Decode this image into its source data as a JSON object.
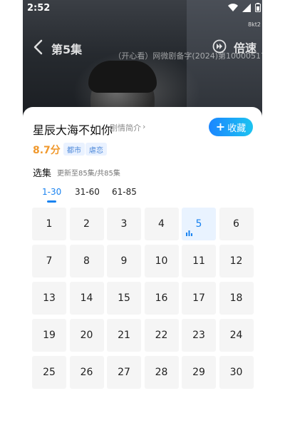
{
  "status_bar": {
    "time": "2:52",
    "icons": [
      "wifi-icon",
      "signal-icon",
      "battery-icon"
    ],
    "tag": "8kt2"
  },
  "player": {
    "episode_title": "第5集",
    "speed_label": "倍速",
    "license_text": "（开心看）网微剧备字(2024)第10000517号"
  },
  "drama": {
    "title": "星辰大海不如你",
    "intro_link": "剧情简介",
    "score": "8.7分",
    "tags": [
      "都市",
      "虐恋"
    ],
    "collect_label": "收藏"
  },
  "episodes": {
    "label": "选集",
    "status": "更新至85集/共85集",
    "ranges": [
      "1-30",
      "31-60",
      "61-85"
    ],
    "active_range": "1-30",
    "current": "5",
    "list": [
      "1",
      "2",
      "3",
      "4",
      "5",
      "6",
      "7",
      "8",
      "9",
      "10",
      "11",
      "12",
      "13",
      "14",
      "15",
      "16",
      "17",
      "18",
      "19",
      "20",
      "21",
      "22",
      "23",
      "24",
      "25",
      "26",
      "27",
      "28",
      "29",
      "30"
    ]
  },
  "colors": {
    "accent": "#1a83f0",
    "score": "#f0982c",
    "tag_bg": "#eaf2ff",
    "tile_bg": "#f5f5f5"
  }
}
